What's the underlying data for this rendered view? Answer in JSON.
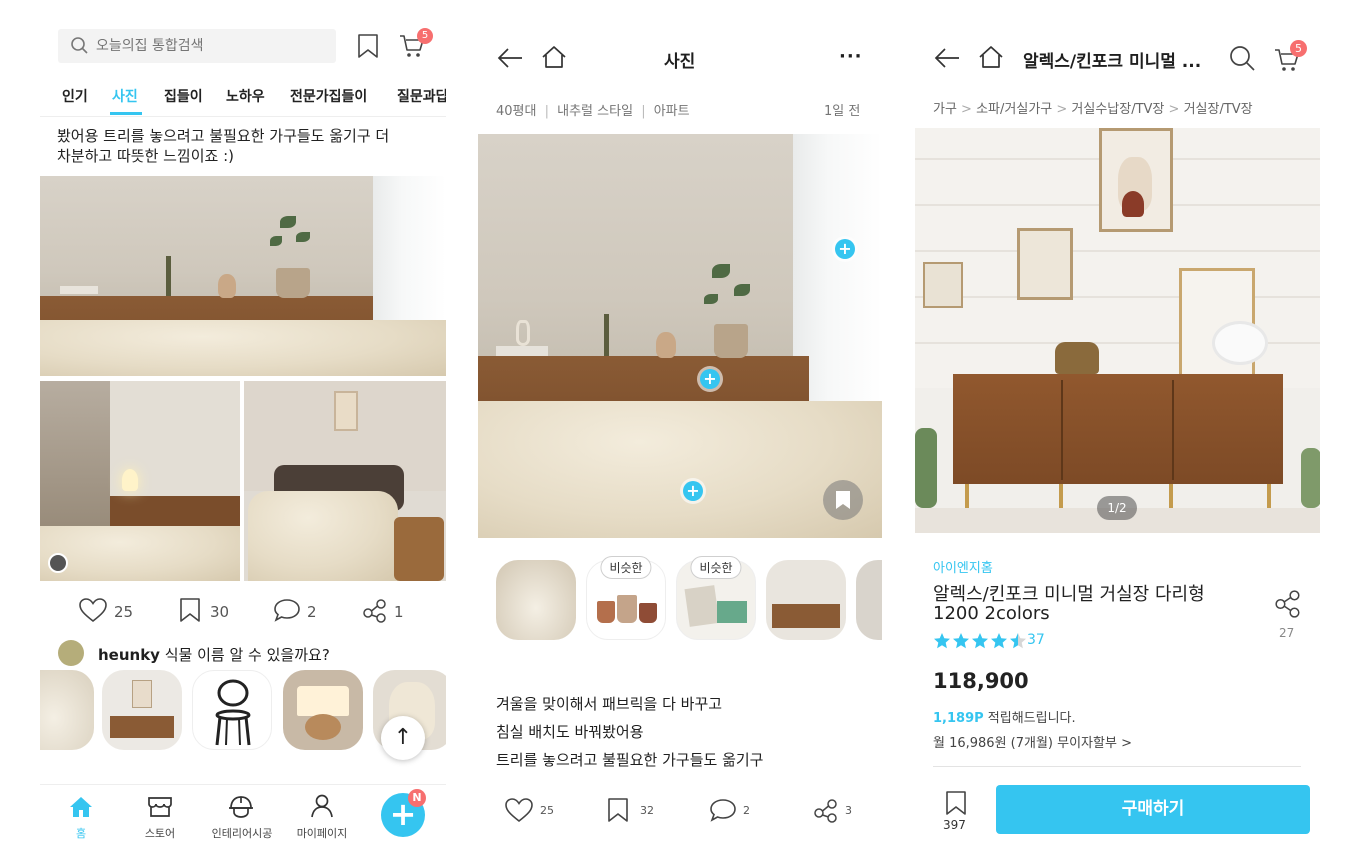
{
  "feed": {
    "search": {
      "placeholder": "오늘의집 통합검색"
    },
    "cart_badge": "5",
    "tabs": [
      "인기",
      "사진",
      "집들이",
      "노하우",
      "전문가집들이",
      "질문과답"
    ],
    "active_tab": 1,
    "caption": [
      "봤어용 트리를 놓으려고 불필요한 가구들도 옮기구 더",
      "차분하고 따뜻한 느낌이죠 :)"
    ],
    "likes": "25",
    "scraps": "30",
    "comments": "2",
    "shares": "1",
    "comment_user": "heunky",
    "comment_text": "식물 이름 알 수 있을까요?",
    "nav": [
      "홈",
      "스토어",
      "인테리어시공",
      "마이페이지"
    ],
    "fab_badge": "N",
    "scroll_top_glyph": "↑",
    "colors": {
      "accent": "#35c5f0",
      "badge": "#f77"
    }
  },
  "detail": {
    "title": "사진",
    "more": "···",
    "meta": {
      "size": "40평대",
      "style": "내추럴 스타일",
      "type": "아파트",
      "time": "1일 전"
    },
    "similar_label": "비슷한",
    "description": [
      "겨울을 맞이해서 패브릭을 다 바꾸고",
      "침실 배치도 바꿔봤어용",
      "트리를 놓으려고 불필요한 가구들도 옮기구"
    ],
    "likes": "25",
    "scraps": "32",
    "comments": "2",
    "shares": "3"
  },
  "product": {
    "header_title": "알렉스/킨포크 미니멀 ...",
    "cart_badge": "5",
    "breadcrumb": [
      "가구",
      "소파/거실가구",
      "거실수납장/TV장",
      "거실장/TV장"
    ],
    "image_counter": "1/2",
    "brand": "아이엔지홈",
    "name_line1": "알렉스/킨포크 미니멀 거실장 다리형",
    "name_line2": "1200 2colors",
    "rating": 4.5,
    "review_count": "37",
    "share_count": "27",
    "price": "118,900",
    "points": "1,189P",
    "points_suffix": "적립해드립니다.",
    "installment": "월 16,986원 (7개월) 무이자할부 >",
    "scrap_count": "397",
    "buy_label": "구매하기"
  }
}
